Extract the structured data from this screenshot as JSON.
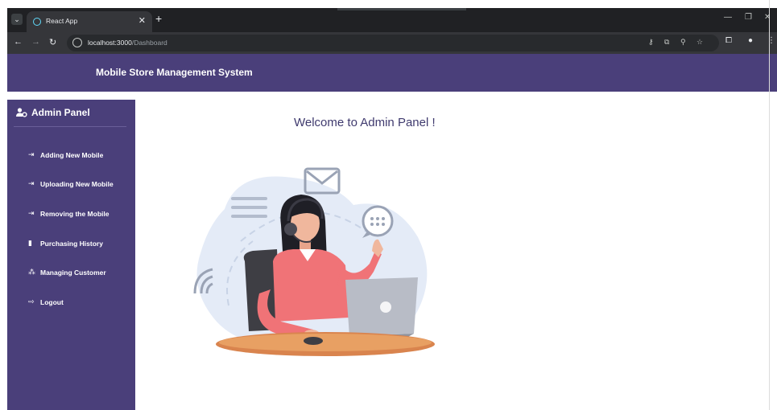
{
  "browser": {
    "tab_title": "React App",
    "url_host": "localhost:3000",
    "url_path": "/Dashboard"
  },
  "app": {
    "title": "Mobile Store Management System"
  },
  "sidebar": {
    "title": "Admin Panel",
    "items": [
      {
        "label": "Adding New Mobile",
        "icon": "login-arrow-icon"
      },
      {
        "label": "Uploading New Mobile",
        "icon": "login-arrow-icon"
      },
      {
        "label": "Removing the Mobile",
        "icon": "login-arrow-icon"
      },
      {
        "label": "Purchasing History",
        "icon": "shopping-bag-icon"
      },
      {
        "label": "Managing Customer",
        "icon": "users-icon"
      },
      {
        "label": "Logout",
        "icon": "logout-icon"
      }
    ]
  },
  "main": {
    "welcome": "Welcome to Admin Panel !"
  },
  "colors": {
    "brand": "#4a3f7a",
    "heading": "#3f3a6e"
  }
}
